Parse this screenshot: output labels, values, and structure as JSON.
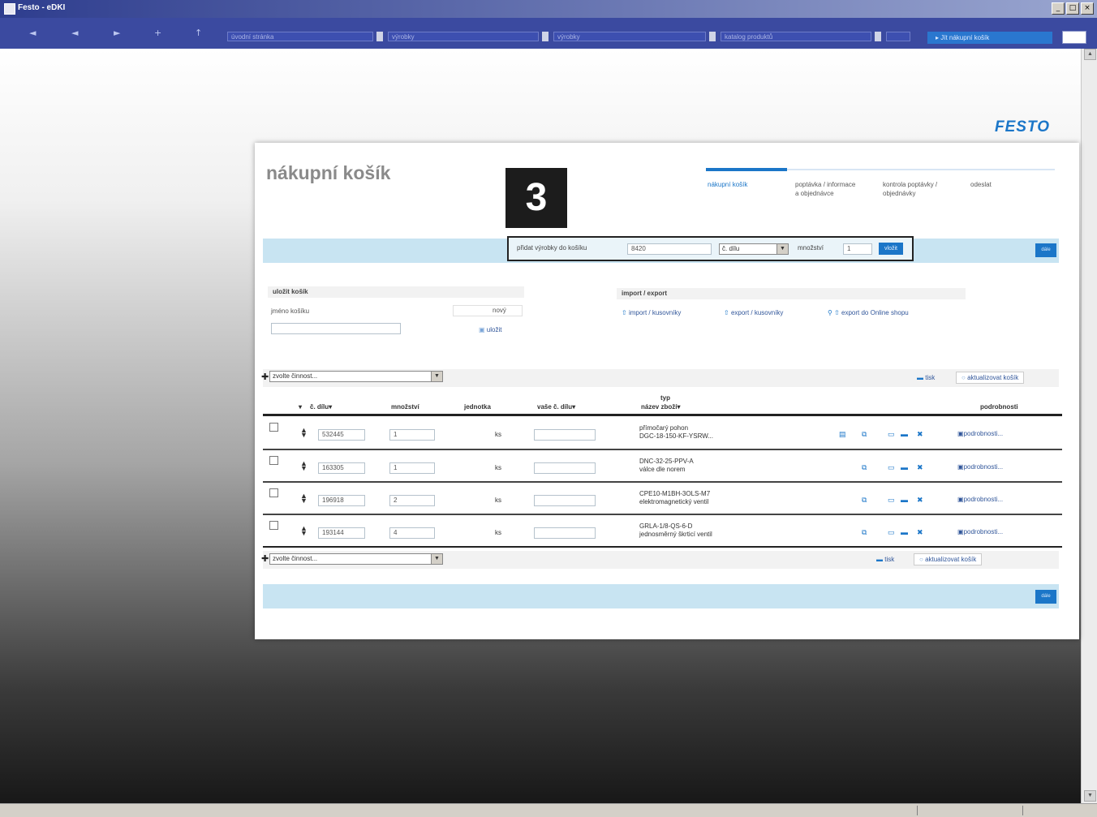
{
  "window": {
    "title": "Festo - eDKI",
    "buttons": [
      "_",
      "□",
      "×"
    ]
  },
  "toolbar": {
    "nav": [
      "◄",
      "◄",
      "►",
      "+",
      "↑"
    ],
    "fields": [
      "úvodní stránka",
      "výrobky",
      "výrobky",
      "katalog produktů",
      ""
    ],
    "cart_button": "▸ Jít nákupní košík"
  },
  "brand": {
    "logo": "FESTO",
    "color": "#1b76c8"
  },
  "page": {
    "title": "nákupní košík",
    "step_badge": "3",
    "steps": [
      {
        "label": "nákupní košík",
        "active": true
      },
      {
        "label": "poptávka / informace a objednávce",
        "active": false
      },
      {
        "label": "kontrola poptávky / objednávky",
        "active": false
      },
      {
        "label": "odeslat",
        "active": false
      }
    ]
  },
  "add_bar": {
    "label": "přidat výrobky do košíku",
    "value": "8420",
    "select": "č. dílu",
    "qty_label": "množství",
    "qty_value": "1",
    "add_button": "vložit",
    "band_button": "dále"
  },
  "save_cart": {
    "heading": "uložit košík",
    "name_label": "jméno košíku",
    "name_value": "",
    "link1": "nový",
    "link2": "uložit"
  },
  "import_export": {
    "heading": "import / export",
    "links": [
      "import / kusovníky",
      "export / kusovníky",
      "export do Online shopu"
    ]
  },
  "actions": {
    "select_label": "zvolte činnost...",
    "print": "tisk",
    "update": "aktualizovat košík"
  },
  "table": {
    "headers": {
      "part_no": "č. dílu▾",
      "qty": "množství",
      "unit": "jednotka",
      "your_no": "vaše č. dílu▾",
      "type_top": "typ",
      "type_bottom": "název zboží▾",
      "details": "podrobnosti"
    },
    "rows": [
      {
        "part": "532445",
        "qty": "1",
        "unit": "ks",
        "your": "",
        "type1": "přímočarý pohon",
        "type2": "DGC-18-150-KF-YSRW...",
        "details": "podrobnosti..."
      },
      {
        "part": "163305",
        "qty": "1",
        "unit": "ks",
        "your": "",
        "type1": "DNC-32-25-PPV-A",
        "type2": "válce dle norem",
        "details": "podrobnosti..."
      },
      {
        "part": "196918",
        "qty": "2",
        "unit": "ks",
        "your": "",
        "type1": "CPE10-M1BH-3OLS-M7",
        "type2": "elektromagnetický ventil",
        "details": "podrobnosti..."
      },
      {
        "part": "193144",
        "qty": "4",
        "unit": "ks",
        "your": "",
        "type1": "GRLA-1/8-QS-6-D",
        "type2": "jednosměrný škrticí ventil",
        "details": "podrobnosti..."
      }
    ]
  },
  "footer_band": {
    "button": "dále"
  }
}
